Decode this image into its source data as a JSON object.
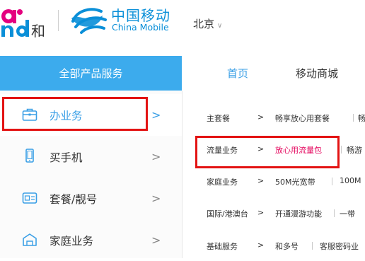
{
  "header": {
    "brand_and_logo_text": "and和",
    "brand_cn": "中国移动",
    "brand_en": "China Mobile",
    "city": "北京",
    "city_dropdown_icon": "chevron-down-icon"
  },
  "navbar": {
    "all_products": "全部产品服务",
    "links": [
      "首页",
      "移动商城"
    ]
  },
  "sidebar": {
    "items": [
      {
        "label": "办业务",
        "icon": "briefcase-icon",
        "active": true
      },
      {
        "label": "买手机",
        "icon": "phone-icon",
        "active": false
      },
      {
        "label": "套餐/靓号",
        "icon": "sim-card-icon",
        "active": false
      },
      {
        "label": "家庭业务",
        "icon": "home-icon",
        "active": false
      }
    ],
    "arrow_glyph": ">"
  },
  "submenu": {
    "rows": [
      {
        "category": "主套餐",
        "arrow": ">",
        "items": [
          "畅享放心用套餐",
          "畅"
        ]
      },
      {
        "category": "流量业务",
        "arrow": ">",
        "items": [
          "放心用流量包",
          "畅游"
        ],
        "highlight": "放心用流量包"
      },
      {
        "category": "家庭业务",
        "arrow": ">",
        "items": [
          "50M光宽带",
          "100M"
        ]
      },
      {
        "category": "国际/港澳台",
        "arrow": ">",
        "items": [
          "开通漫游功能",
          "一带"
        ]
      },
      {
        "category": "基础服务",
        "arrow": ">",
        "items": [
          "和多号",
          "客服密码业"
        ]
      }
    ]
  },
  "colors": {
    "accent_blue": "#3cabed",
    "link_blue": "#3a9fe6",
    "highlight_pink": "#e4005a",
    "annotation_red": "#e31313",
    "logo_pink": "#e4007f"
  }
}
